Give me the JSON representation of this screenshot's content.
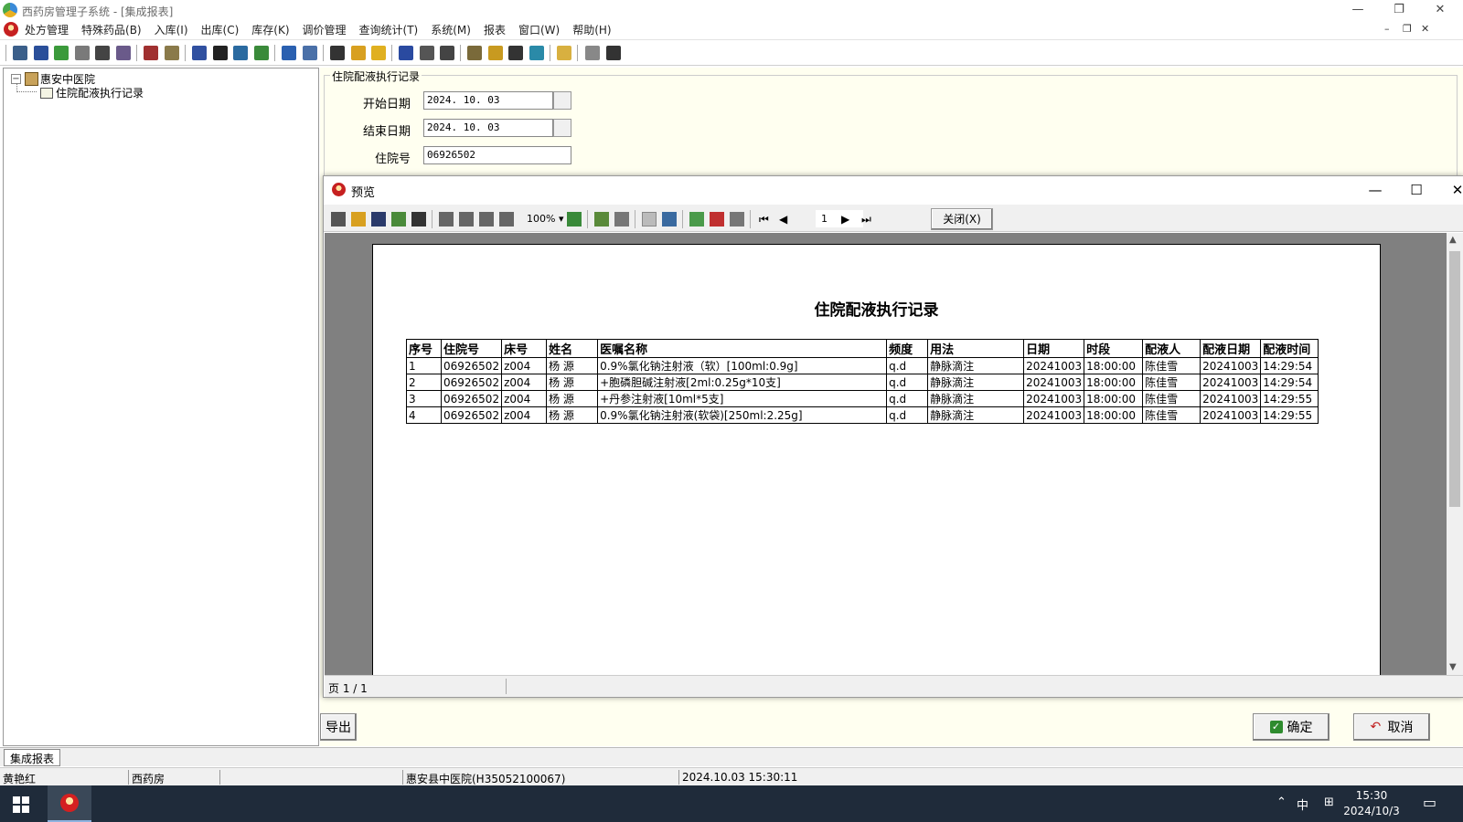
{
  "window": {
    "title": "西药房管理子系统 - [集成报表]",
    "controls": [
      "—",
      "❐",
      "✕"
    ],
    "mdi_controls": [
      "–",
      "❐",
      "✕"
    ]
  },
  "menu": {
    "items": [
      "处方管理",
      "特殊药品(B)",
      "入库(I)",
      "出库(C)",
      "库存(K)",
      "调价管理",
      "查询统计(T)",
      "系统(M)",
      "报表",
      "窗口(W)",
      "帮助(H)"
    ]
  },
  "tree": {
    "root": "惠安中医院",
    "child": "住院配液执行记录"
  },
  "form": {
    "group_title": "住院配液执行记录",
    "start_label": "开始日期",
    "start_value": "2024. 10. 03",
    "end_label": "结束日期",
    "end_value": "2024. 10. 03",
    "inpatient_label": "住院号",
    "inpatient_value": "06926502",
    "export_label": "导出",
    "ok_label": "确定",
    "cancel_label": "取消"
  },
  "preview": {
    "title": "预览",
    "zoom": "100%",
    "page_input": "1",
    "close_label": "关闭(X)",
    "status": "页 1 / 1",
    "report_title": "住院配液执行记录",
    "columns": [
      "序号",
      "住院号",
      "床号",
      "姓名",
      "医嘱名称",
      "频度",
      "用法",
      "日期",
      "时段",
      "配液人",
      "配液日期",
      "配液时间"
    ],
    "rows": [
      [
        "1",
        "06926502",
        "z004",
        "杨 源",
        "0.9%氯化钠注射液（软）[100ml:0.9g]",
        "q.d",
        "静脉滴注",
        "20241003",
        "18:00:00",
        "陈佳雪",
        "20241003",
        "14:29:54"
      ],
      [
        "2",
        "06926502",
        "z004",
        "杨 源",
        "+胞磷胆碱注射液[2ml:0.25g*10支]",
        "q.d",
        "静脉滴注",
        "20241003",
        "18:00:00",
        "陈佳雪",
        "20241003",
        "14:29:54"
      ],
      [
        "3",
        "06926502",
        "z004",
        "杨 源",
        "+丹参注射液[10ml*5支]",
        "q.d",
        "静脉滴注",
        "20241003",
        "18:00:00",
        "陈佳雪",
        "20241003",
        "14:29:55"
      ],
      [
        "4",
        "06926502",
        "z004",
        "杨 源",
        "0.9%氯化钠注射液(软袋)[250ml:2.25g]",
        "q.d",
        "静脉滴注",
        "20241003",
        "18:00:00",
        "陈佳雪",
        "20241003",
        "14:29:55"
      ]
    ]
  },
  "tabbar": {
    "tab": "集成报表"
  },
  "statusbar": {
    "user": "黄艳红",
    "dept": "西药房",
    "hospital": "惠安县中医院(H35052100067)",
    "datetime": "2024.10.03 15:30:11"
  },
  "taskbar": {
    "ime": "中",
    "time": "15:30",
    "date": "2024/10/3"
  },
  "colors": {
    "form_bg": "#fffff0",
    "preview_bg": "#808080",
    "taskbar_bg": "#1f2b3a"
  }
}
